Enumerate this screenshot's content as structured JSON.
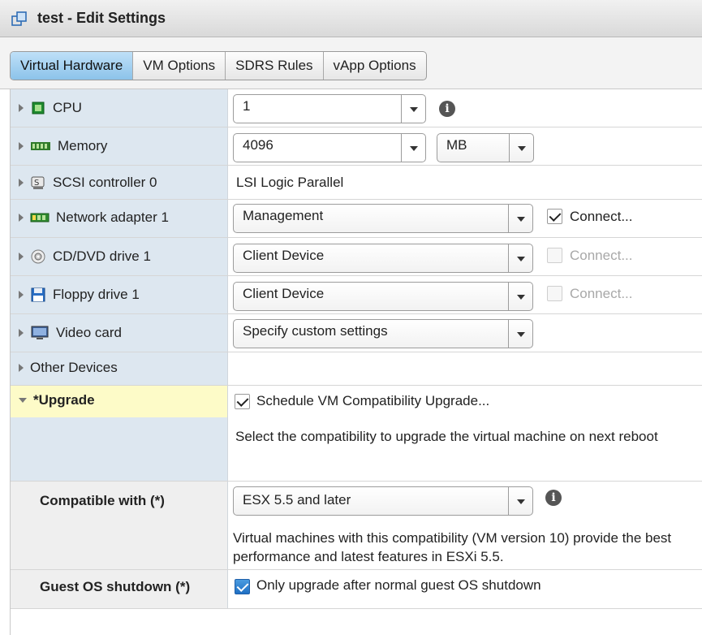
{
  "window": {
    "title": "test - Edit Settings",
    "title_icon": "vm-settings-icon"
  },
  "tabs": [
    {
      "label": "Virtual Hardware",
      "active": true
    },
    {
      "label": "VM Options",
      "active": false
    },
    {
      "label": "SDRS Rules",
      "active": false
    },
    {
      "label": "vApp Options",
      "active": false
    }
  ],
  "hardware": {
    "cpu": {
      "label": "CPU",
      "value": "1"
    },
    "memory": {
      "label": "Memory",
      "value": "4096",
      "unit": "MB"
    },
    "scsi": {
      "label": "SCSI controller 0",
      "value": "LSI Logic Parallel"
    },
    "network": {
      "label": "Network adapter 1",
      "value": "Management",
      "connect_label": "Connect...",
      "connected": true
    },
    "cddvd": {
      "label": "CD/DVD drive 1",
      "value": "Client Device",
      "connect_label": "Connect...",
      "connected": false
    },
    "floppy": {
      "label": "Floppy drive 1",
      "value": "Client Device",
      "connect_label": "Connect...",
      "connected": false
    },
    "video": {
      "label": "Video card",
      "value": "Specify custom settings"
    },
    "other": {
      "label": "Other Devices"
    }
  },
  "upgrade": {
    "label": "*Upgrade",
    "schedule_label": "Schedule VM Compatibility Upgrade...",
    "description": "Select the compatibility to upgrade the virtual machine on next reboot",
    "compatible_label": "Compatible with (*)",
    "compatible_value": "ESX 5.5 and later",
    "compatible_note": "Virtual machines with this compatibility (VM version 10) provide the best performance and latest features in ESXi 5.5.",
    "guest_label": "Guest OS shutdown (*)",
    "guest_option": "Only upgrade after normal guest OS shutdown"
  }
}
